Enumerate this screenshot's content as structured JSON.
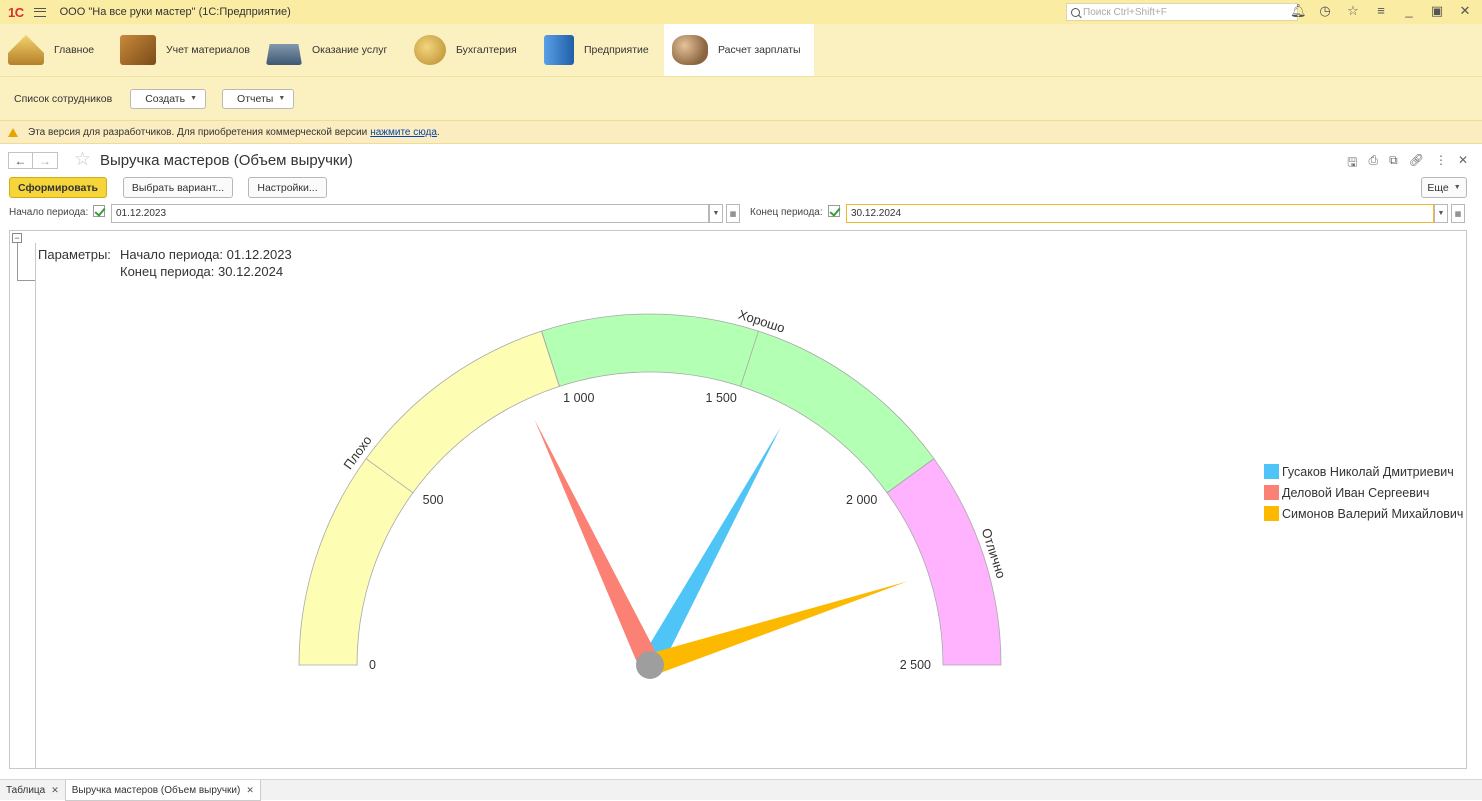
{
  "titlebar": {
    "logo": "1С",
    "title": "ООО \"На все руки мастер\"  (1С:Предприятие)",
    "search_placeholder": "Поиск Ctrl+Shift+F"
  },
  "sections": [
    {
      "label": "Главное",
      "icon": "home-icon"
    },
    {
      "label": "Учет материалов",
      "icon": "boxes-icon"
    },
    {
      "label": "Оказание услуг",
      "icon": "cash-register-icon"
    },
    {
      "label": "Бухгалтерия",
      "icon": "coins-icon"
    },
    {
      "label": "Предприятие",
      "icon": "building-icon"
    },
    {
      "label": "Расчет зарплаты",
      "icon": "people-icon"
    }
  ],
  "commandbar": {
    "list_label": "Список сотрудников",
    "create_label": "Создать",
    "reports_label": "Отчеты"
  },
  "devbar": {
    "text": "Эта версия для разработчиков. Для приобретения коммерческой версии",
    "link": "нажмите сюда",
    "suffix": "."
  },
  "form": {
    "title": "Выручка мастеров (Объем выручки)",
    "generate_label": "Сформировать",
    "variant_label": "Выбрать вариант...",
    "settings_label": "Настройки...",
    "more_label": "Еще",
    "start_label": "Начало периода:",
    "start_value": "01.12.2023",
    "end_label": "Конец периода:",
    "end_value": "30.12.2024"
  },
  "report": {
    "params_label": "Параметры:",
    "param_start": "Начало периода: 01.12.2023",
    "param_end": "Конец периода: 30.12.2024"
  },
  "chart_data": {
    "type": "gauge",
    "min": 0,
    "max": 2500,
    "ticks": [
      {
        "value": 0,
        "label": "0"
      },
      {
        "value": 500,
        "label": "500"
      },
      {
        "value": 1000,
        "label": "1 000"
      },
      {
        "value": 1500,
        "label": "1 500"
      },
      {
        "value": 2000,
        "label": "2 000"
      },
      {
        "value": 2500,
        "label": "2 500"
      }
    ],
    "bands": [
      {
        "from": 0,
        "to": 1000,
        "label": "Плохо",
        "color": "#fdfdb4"
      },
      {
        "from": 1000,
        "to": 2000,
        "label": "Хорошо",
        "color": "#b3ffb3"
      },
      {
        "from": 2000,
        "to": 2500,
        "label": "Отлично",
        "color": "#ffb3ff"
      }
    ],
    "series": [
      {
        "name": "Гусаков Николай Дмитриевич",
        "value": 1650,
        "color": "#4fc4f7"
      },
      {
        "name": "Деловой Иван Сергеевич",
        "value": 900,
        "color": "#fa8174"
      },
      {
        "name": "Симонов Валерий Михайлович",
        "value": 2250,
        "color": "#fdb800"
      }
    ]
  },
  "bottom_tabs": [
    {
      "label": "Таблица"
    },
    {
      "label": "Выручка мастеров (Объем выручки)"
    }
  ]
}
